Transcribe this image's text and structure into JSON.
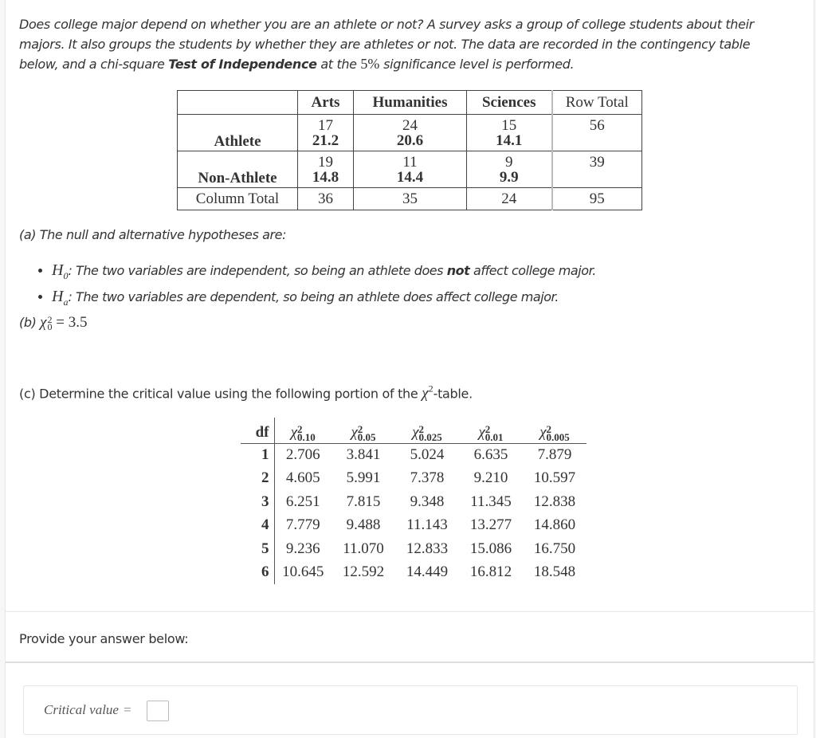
{
  "intro": {
    "text_1": "Does college major depend on whether you are an athlete or not? A survey asks a group of college students about their majors. It also groups the students by whether they are athletes or not. The data are recorded in the contingency table below, and a chi-square ",
    "bold": "Test of Independence",
    "text_2": " at the ",
    "significance": "5%",
    "text_3": " significance level is performed."
  },
  "contingency_table": {
    "column_headers": [
      "",
      "Arts",
      "Humanities",
      "Sciences",
      "Row Total"
    ],
    "rows": [
      {
        "label": "Athlete",
        "cells": [
          {
            "observed": "17",
            "expected": "21.2"
          },
          {
            "observed": "24",
            "expected": "20.6"
          },
          {
            "observed": "15",
            "expected": "14.1"
          }
        ],
        "row_total": "56"
      },
      {
        "label": "Non-Athlete",
        "cells": [
          {
            "observed": "19",
            "expected": "14.8"
          },
          {
            "observed": "11",
            "expected": "14.4"
          },
          {
            "observed": "9",
            "expected": "9.9"
          }
        ],
        "row_total": "39"
      }
    ],
    "column_total": {
      "label": "Column Total",
      "values": [
        "36",
        "35",
        "24",
        "95"
      ]
    }
  },
  "part_a": {
    "label": "(a) The null and alternative hypotheses are:",
    "h0": {
      "symbol": "H",
      "sub": "0",
      "text_1": ": The two variables are independent, so being an athlete does ",
      "bold": "not",
      "text_2": " affect college major."
    },
    "ha": {
      "symbol": "H",
      "sub": "a",
      "text": ": The two variables are dependent, so being an athlete does affect college major."
    }
  },
  "part_b": {
    "label": "(b)",
    "symbol": "χ",
    "sup": "2",
    "sub": "0",
    "equals": "= 3.5"
  },
  "part_c": {
    "text_1": "(c) Determine the critical value using the following portion of the ",
    "symbol": "χ",
    "sup": "2",
    "text_2": "-table."
  },
  "chi_square_table": {
    "df_header": "df",
    "columns": [
      {
        "symbol": "χ",
        "sup": "2",
        "sub": "0.10"
      },
      {
        "symbol": "χ",
        "sup": "2",
        "sub": "0.05"
      },
      {
        "symbol": "χ",
        "sup": "2",
        "sub": "0.025"
      },
      {
        "symbol": "χ",
        "sup": "2",
        "sub": "0.01"
      },
      {
        "symbol": "χ",
        "sup": "2",
        "sub": "0.005"
      }
    ],
    "rows": [
      {
        "df": "1",
        "values": [
          "2.706",
          "3.841",
          "5.024",
          "6.635",
          "7.879"
        ]
      },
      {
        "df": "2",
        "values": [
          "4.605",
          "5.991",
          "7.378",
          "9.210",
          "10.597"
        ]
      },
      {
        "df": "3",
        "values": [
          "6.251",
          "7.815",
          "9.348",
          "11.345",
          "12.838"
        ]
      },
      {
        "df": "4",
        "values": [
          "7.779",
          "9.488",
          "11.143",
          "13.277",
          "14.860"
        ]
      },
      {
        "df": "5",
        "values": [
          "9.236",
          "11.070",
          "12.833",
          "15.086",
          "16.750"
        ]
      },
      {
        "df": "6",
        "values": [
          "10.645",
          "12.592",
          "14.449",
          "16.812",
          "18.548"
        ]
      }
    ]
  },
  "answer": {
    "prompt": "Provide your answer below:",
    "label": "Critical value",
    "equals": "=",
    "value": ""
  }
}
